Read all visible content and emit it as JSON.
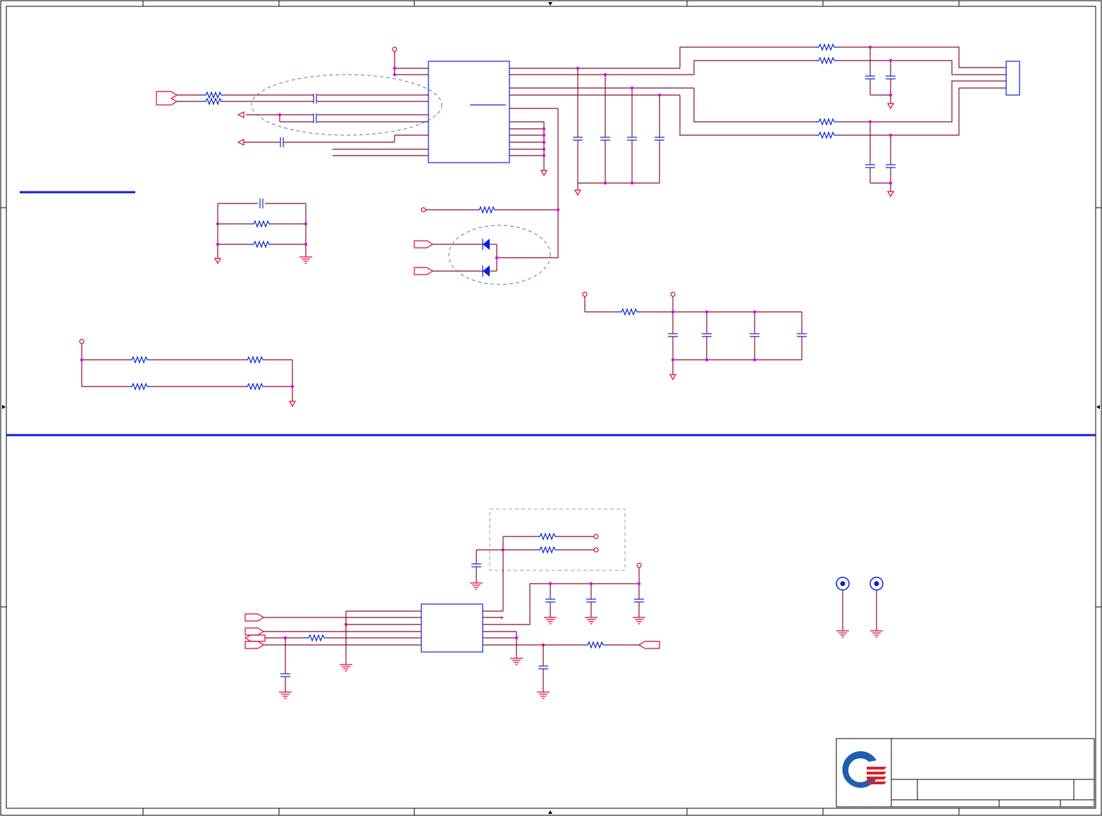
{
  "diagram": {
    "kind": "electrical schematic",
    "colors": {
      "wire": "#8b0a2e",
      "net_port": "#e0002a",
      "component": "#0a1fd6",
      "junction": "#e000e0",
      "separator": "#0a1fd6",
      "frame": "#000000"
    },
    "logo": {
      "name": "company-logo-icon",
      "colors": [
        "#1f5fb0",
        "#d8202a"
      ]
    },
    "title_block": {
      "title": "",
      "size": "",
      "document_number": "",
      "rev": "",
      "date": "",
      "sheet": ""
    }
  }
}
